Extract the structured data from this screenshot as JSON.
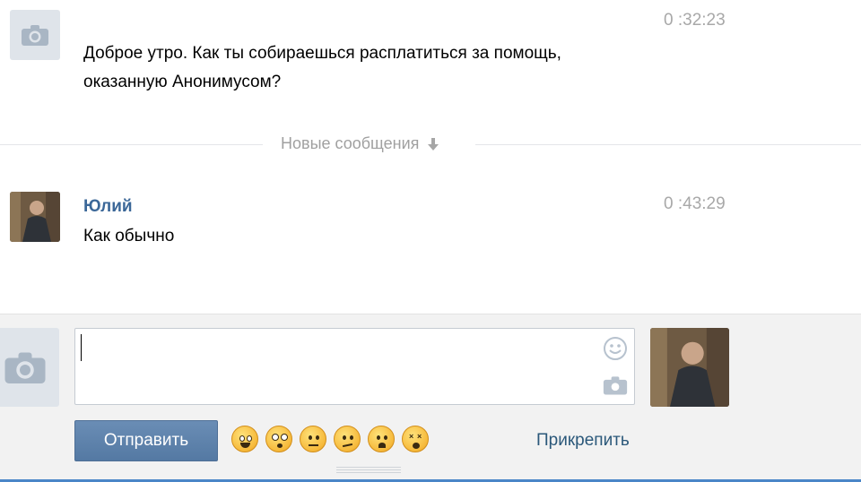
{
  "messages": [
    {
      "author": "",
      "text": "Доброе утро. Как ты собираешься расплатиться за помощь,\nоказанную Анонимусом?",
      "time": "0 :32:23",
      "avatar": "camera-icon"
    },
    {
      "author": "Юлий",
      "text": "Как обычно",
      "time": "0 :43:29",
      "avatar": "user-photo"
    }
  ],
  "divider": {
    "label": "Новые сообщения",
    "icon": "arrow-down-icon"
  },
  "composer": {
    "input_value": "",
    "send_label": "Отправить",
    "attach_label": "Прикрепить",
    "emoji": [
      "grin-icon",
      "shocked-icon",
      "neutral-icon",
      "confused-icon",
      "sad-icon",
      "dizzy-icon"
    ],
    "icons": {
      "smile": "smile-icon",
      "photo": "camera-icon"
    }
  },
  "colors": {
    "author": "#3b6798",
    "time": "#a8a8a8",
    "send_button": "#5f83ad",
    "link": "#2b587a",
    "composer_bg": "#f2f2f2"
  }
}
